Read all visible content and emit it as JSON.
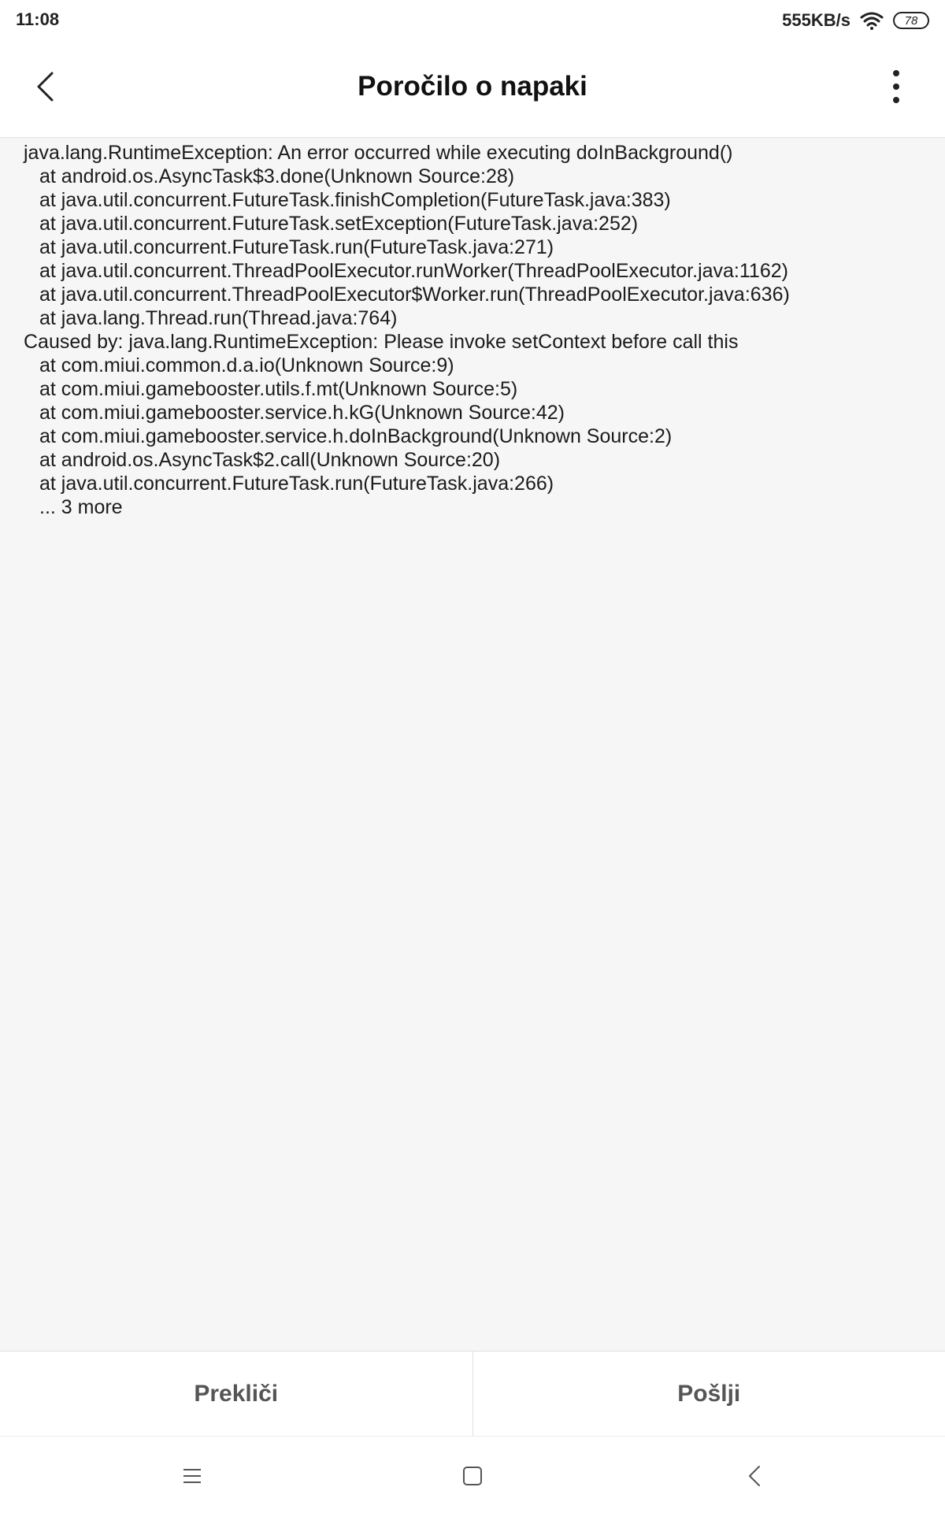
{
  "status_bar": {
    "time": "11:08",
    "network_speed": "555KB/s",
    "battery_level": "78",
    "icons": [
      "wifi-icon",
      "battery-icon"
    ]
  },
  "header": {
    "title": "Poročilo o napaki",
    "back_icon": "chevron-left-icon",
    "menu_icon": "more-vertical-icon"
  },
  "stack_trace": [
    {
      "text": "java.lang.RuntimeException: An error occurred while executing doInBackground()",
      "indent": false
    },
    {
      "text": "at android.os.AsyncTask$3.done(Unknown Source:28)",
      "indent": true
    },
    {
      "text": "at java.util.concurrent.FutureTask.finishCompletion(FutureTask.java:383)",
      "indent": true
    },
    {
      "text": "at java.util.concurrent.FutureTask.setException(FutureTask.java:252)",
      "indent": true
    },
    {
      "text": "at java.util.concurrent.FutureTask.run(FutureTask.java:271)",
      "indent": true
    },
    {
      "text": "at java.util.concurrent.ThreadPoolExecutor.runWorker(ThreadPoolExecutor.java:1162)",
      "indent": true
    },
    {
      "text": "at java.util.concurrent.ThreadPoolExecutor$Worker.run(ThreadPoolExecutor.java:636)",
      "indent": true
    },
    {
      "text": "at java.lang.Thread.run(Thread.java:764)",
      "indent": true
    },
    {
      "text": "Caused by: java.lang.RuntimeException: Please invoke setContext before call this",
      "indent": false
    },
    {
      "text": "at com.miui.common.d.a.io(Unknown Source:9)",
      "indent": true
    },
    {
      "text": "at com.miui.gamebooster.utils.f.mt(Unknown Source:5)",
      "indent": true
    },
    {
      "text": "at com.miui.gamebooster.service.h.kG(Unknown Source:42)",
      "indent": true
    },
    {
      "text": "at com.miui.gamebooster.service.h.doInBackground(Unknown Source:2)",
      "indent": true
    },
    {
      "text": "at android.os.AsyncTask$2.call(Unknown Source:20)",
      "indent": true
    },
    {
      "text": "at java.util.concurrent.FutureTask.run(FutureTask.java:266)",
      "indent": true
    },
    {
      "text": "... 3 more",
      "indent": true
    }
  ],
  "actions": {
    "cancel_label": "Prekliči",
    "send_label": "Pošlji"
  },
  "nav_bar": {
    "icons": [
      "menu-icon",
      "home-icon",
      "back-icon"
    ]
  }
}
